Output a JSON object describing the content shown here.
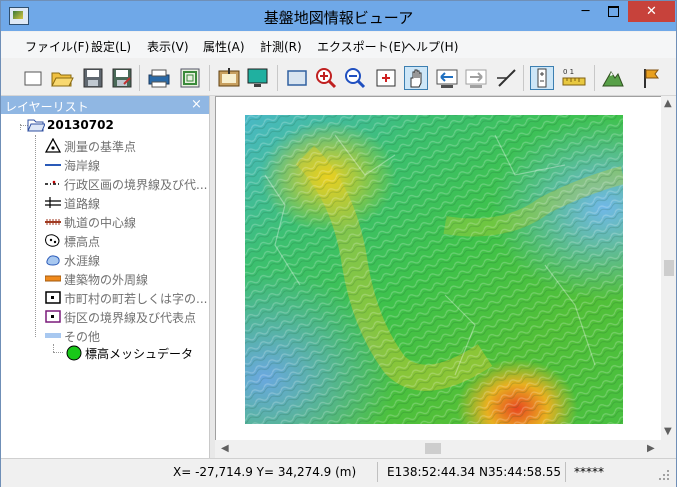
{
  "window": {
    "title": "基盤地図情報ビューア",
    "controls": {
      "minimize": "─",
      "close": "✕"
    }
  },
  "menu": [
    "ファイル(F)",
    "設定(L)",
    "表示(V)",
    "属性(A)",
    "計測(R)",
    "エクスポート(E)",
    "ヘルプ(H)"
  ],
  "toolbar": {
    "buttons": [
      {
        "icon": "new-document-icon"
      },
      {
        "icon": "open-folder-icon"
      },
      {
        "icon": "save-icon"
      },
      {
        "icon": "save-as-icon"
      },
      {
        "icon": "print-icon"
      },
      {
        "icon": "print-preview-icon"
      },
      {
        "icon": "export-image-icon"
      },
      {
        "icon": "display-settings-icon"
      },
      {
        "icon": "full-extent-icon"
      },
      {
        "icon": "zoom-in-icon"
      },
      {
        "icon": "zoom-out-icon"
      },
      {
        "icon": "center-icon"
      },
      {
        "icon": "pan-hand-icon"
      },
      {
        "icon": "back-icon"
      },
      {
        "icon": "forward-icon"
      },
      {
        "icon": "measure-line-icon"
      },
      {
        "icon": "select-tool-icon"
      },
      {
        "icon": "scale-ruler-icon"
      },
      {
        "icon": "terrain-icon"
      },
      {
        "icon": "flag-icon"
      }
    ],
    "scale_ruler_label": "0 1"
  },
  "layer_panel": {
    "title": "レイヤーリスト",
    "close": "×",
    "root": "20130702",
    "layers": [
      {
        "label": "測量の基準点",
        "symbol": "survey-point-icon"
      },
      {
        "label": "海岸線",
        "symbol": "coastline-icon"
      },
      {
        "label": "行政区画の境界線及び代...",
        "symbol": "admin-boundary-icon"
      },
      {
        "label": "道路線",
        "symbol": "road-line-icon"
      },
      {
        "label": "軌道の中心線",
        "symbol": "railway-icon"
      },
      {
        "label": "標高点",
        "symbol": "elevation-point-icon"
      },
      {
        "label": "水涯線",
        "symbol": "waterline-icon"
      },
      {
        "label": "建築物の外周線",
        "symbol": "building-outline-icon"
      },
      {
        "label": "市町村の町若しくは字の...",
        "symbol": "town-boundary-icon"
      },
      {
        "label": "街区の境界線及び代表点",
        "symbol": "block-boundary-icon"
      },
      {
        "label": "その他",
        "symbol": "other-icon"
      }
    ],
    "mesh_layer": {
      "label": "標高メッシュデータ",
      "color": "#19c819"
    }
  },
  "status": {
    "xy": "X= -27,714.9 Y= 34,274.9 (m)",
    "lonlat": "E138:52:44.34 N35:44:58.55",
    "extra": "*****"
  },
  "colors": {
    "titlebar": "#6fa8e8",
    "panel_header": "#90b7e3",
    "close_button": "#c7423b"
  }
}
